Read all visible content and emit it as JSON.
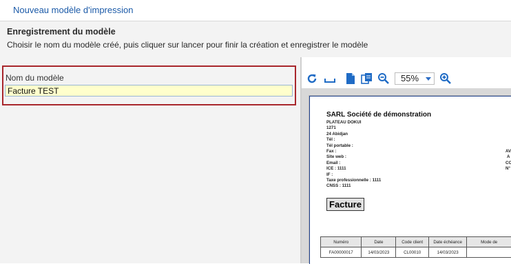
{
  "window": {
    "title": "Nouveau modèle d'impression"
  },
  "header": {
    "title": "Enregistrement du modèle",
    "subtitle": "Choisir le nom du modèle créé, puis cliquer sur lancer pour finir la création et enregistrer le modèle"
  },
  "form": {
    "name_label": "Nom du modèle",
    "name_value": "Facture TEST"
  },
  "toolbar": {
    "zoom_value": "55%",
    "icons": [
      "refresh-icon",
      "page-width-icon",
      "page-icon",
      "multi-page-icon",
      "zoom-out-icon",
      "zoom-in-icon"
    ],
    "accent": "#1f6bc5"
  },
  "document": {
    "company": "SARL Société de démonstration",
    "address_lines": [
      "PLATEAU DOKUI",
      "1271",
      "24 Abidjan",
      "Tél :",
      "Tél portable :",
      "Fax :",
      "Site web :",
      "Email :",
      "ICE : 1111",
      "IF :",
      "Taxe professionnelle : 1111",
      "CNSS : 1111"
    ],
    "right_lines": [
      "AV",
      "A",
      "CC",
      "N°"
    ],
    "title": "Facture",
    "table": {
      "headers": [
        "Numéro",
        "Date",
        "Code client",
        "Date échéance",
        "Mode de"
      ],
      "row": [
        "FA00000017",
        "14/03/2023",
        "CL00010",
        "14/03/2023",
        ""
      ]
    }
  },
  "colors": {
    "title_blue": "#1b5aa8",
    "highlight_border": "#a8262b",
    "input_bg": "#ffffcc"
  }
}
